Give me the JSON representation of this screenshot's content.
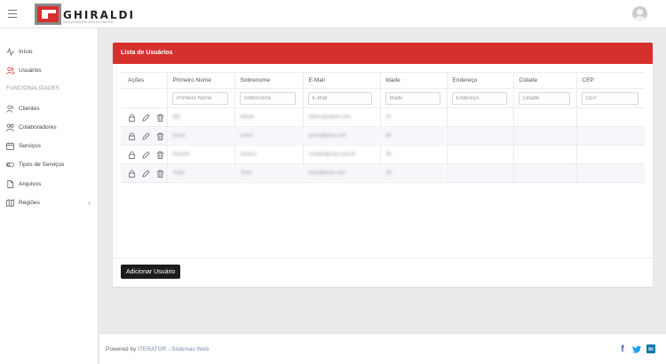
{
  "header": {
    "logo_text": "GHIRALDI",
    "logo_sub": "ADVOGADOS ASSOCIADOS"
  },
  "sidebar": {
    "items": [
      {
        "label": "Início",
        "icon": "activity-icon"
      },
      {
        "label": "Usuários",
        "icon": "users-icon"
      },
      {
        "label": "Clientes",
        "icon": "users-icon"
      },
      {
        "label": "Colaboradores",
        "icon": "user-group-icon"
      },
      {
        "label": "Serviços",
        "icon": "calendar-icon"
      },
      {
        "label": "Tipos de Serviços",
        "icon": "toggle-icon"
      },
      {
        "label": "Arquivos",
        "icon": "file-icon"
      },
      {
        "label": "Regiões",
        "icon": "map-icon"
      }
    ],
    "section_heading": "FUNCIONALIDADES",
    "expand_arrow": "‹"
  },
  "card": {
    "title": "Lista de Usuários",
    "columns": [
      "Ações",
      "Primeiro Nome",
      "Sobrenome",
      "E-Mail",
      "Idade",
      "Endereço",
      "Cidade",
      "CEP"
    ],
    "filters": [
      "Primeiro Nome",
      "Sobrenome",
      "E-Mail",
      "Idade",
      "Endereço",
      "Cidade",
      "CEP"
    ],
    "rows": [
      {
        "first": "Mi1",
        "last": "Admin",
        "email": "admin@admin.com",
        "age": "25"
      },
      {
        "first": "User1",
        "last": "User1",
        "email": "user1@user.com",
        "age": "30"
      },
      {
        "first": "Ricardo",
        "last": "Avelino",
        "email": "contato@ciclo.com.br",
        "age": "38"
      },
      {
        "first": "Teste",
        "last": "Teste",
        "email": "teste@teste.com",
        "age": "30"
      }
    ],
    "add_button": "Adicionar Usuário"
  },
  "footer": {
    "prefix": "Powered by",
    "link": "ITERATOR - Sistemas Web"
  },
  "colors": {
    "accent": "#d6302e",
    "button": "#1c1c1c",
    "facebook": "#3b5998",
    "twitter": "#1da1f2",
    "linkedin": "#0e76a8"
  }
}
